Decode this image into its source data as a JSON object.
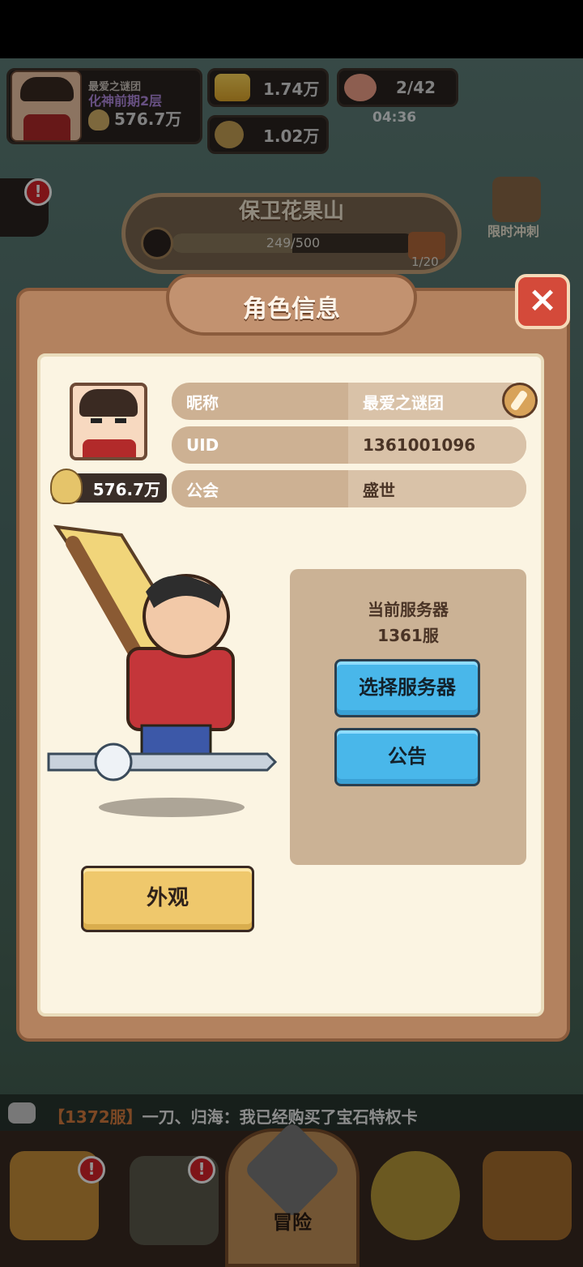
{
  "hud": {
    "player_name": "最爱之谜团",
    "realm": "化神前期2层",
    "power": "576.7万",
    "gold": "1.74万",
    "coins": "1.02万",
    "stamina": "2/42",
    "stamina_timer": "04:36"
  },
  "event": {
    "title": "保卫花果山",
    "progress_text": "249/500",
    "progress_fraction": 0.498,
    "chest_count": "1/20",
    "sprint_label": "限时冲刺"
  },
  "modal": {
    "title": "角色信息",
    "power": "576.7万",
    "rows": [
      {
        "key": "昵称",
        "value": "最爱之谜团"
      },
      {
        "key": "UID",
        "value": "1361001096"
      },
      {
        "key": "公会",
        "value": "盛世"
      }
    ],
    "server_label": "当前服务器",
    "server_value": "1361服",
    "select_server_label": "选择服务器",
    "notice_label": "公告",
    "appearance_label": "外观"
  },
  "chat": {
    "server": "【1372服】",
    "message": "一刀、归海：我已经购买了宝石特权卡"
  },
  "bottom_nav": {
    "adventure_label": "冒险"
  },
  "colors": {
    "modal_bg": "#b3825f",
    "panel_bg": "#fbf4e2",
    "blue_button": "#49b7ea",
    "gold_button": "#efc86c",
    "close_red": "#d44a3a"
  }
}
